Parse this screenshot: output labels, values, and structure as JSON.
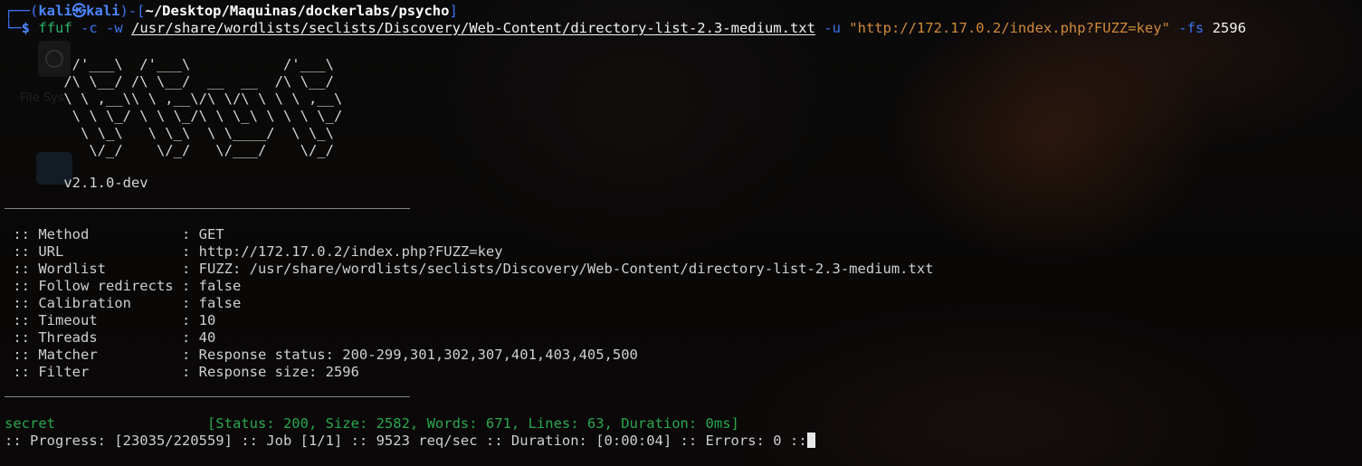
{
  "prompt": {
    "user": "kali",
    "symbol": "㉿",
    "host": "kali",
    "path": "~/Desktop/Maquinas/dockerlabs/psycho",
    "dollar": "$"
  },
  "command": {
    "binary": "ffuf",
    "flag_c": "-c",
    "flag_w": "-w",
    "wordlist": "/usr/share/wordlists/seclists/Discovery/Web-Content/directory-list-2.3-medium.txt",
    "flag_u": "-u",
    "url": "\"http://172.17.0.2/index.php?FUZZ=key\"",
    "flag_fs": "-fs",
    "fs_value": "2596"
  },
  "banner": [
    "        /'___\\  /'___\\           /'___\\",
    "       /\\ \\__/ /\\ \\__/  __  __  /\\ \\__/",
    "       \\ \\ ,__\\\\ \\ ,__\\/\\ \\/\\ \\ \\ \\ ,__\\",
    "        \\ \\ \\_/ \\ \\ \\_/\\ \\ \\_\\ \\ \\ \\ \\_/",
    "         \\ \\_\\   \\ \\_\\  \\ \\____/  \\ \\_\\",
    "          \\/_/    \\/_/   \\/___/    \\/_/"
  ],
  "version": "       v2.1.0-dev",
  "rule": "________________________________________________",
  "config": [
    {
      "key": " :: Method           ",
      "value": ": GET"
    },
    {
      "key": " :: URL              ",
      "value": ": http://172.17.0.2/index.php?FUZZ=key"
    },
    {
      "key": " :: Wordlist         ",
      "value": ": FUZZ: /usr/share/wordlists/seclists/Discovery/Web-Content/directory-list-2.3-medium.txt"
    },
    {
      "key": " :: Follow redirects ",
      "value": ": false"
    },
    {
      "key": " :: Calibration      ",
      "value": ": false"
    },
    {
      "key": " :: Timeout          ",
      "value": ": 10"
    },
    {
      "key": " :: Threads          ",
      "value": ": 40"
    },
    {
      "key": " :: Matcher          ",
      "value": ": Response status: 200-299,301,302,307,401,403,405,500"
    },
    {
      "key": " :: Filter           ",
      "value": ": Response size: 2596"
    }
  ],
  "result": {
    "word": "secret                  ",
    "details": "[Status: 200, Size: 2582, Words: 671, Lines: 63, Duration: 0ms]"
  },
  "progress": ":: Progress: [23035/220559] :: Job [1/1] :: 9523 req/sec :: Duration: [0:00:04] :: Errors: 0 ::",
  "desktop": {
    "file_system_label": "File Sys"
  }
}
